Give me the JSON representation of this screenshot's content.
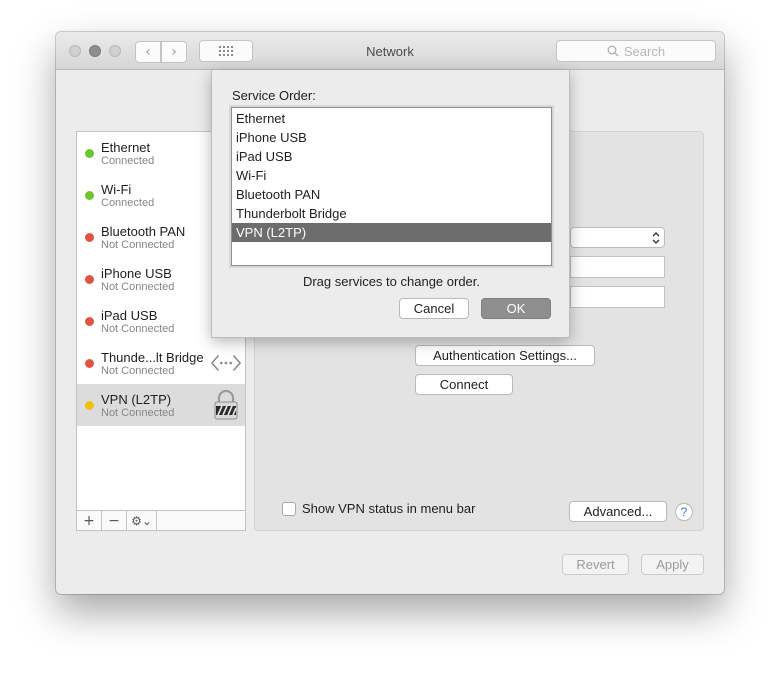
{
  "window": {
    "title": "Network",
    "search_placeholder": "Search"
  },
  "services": [
    {
      "name": "Ethernet",
      "status": "Connected",
      "color": "#6fc52e"
    },
    {
      "name": "Wi-Fi",
      "status": "Connected",
      "color": "#6fc52e"
    },
    {
      "name": "Bluetooth PAN",
      "status": "Not Connected",
      "color": "#e05540"
    },
    {
      "name": "iPhone USB",
      "status": "Not Connected",
      "color": "#e05540"
    },
    {
      "name": "iPad USB",
      "status": "Not Connected",
      "color": "#e05540"
    },
    {
      "name": "Thunde...lt Bridge",
      "status": "Not Connected",
      "color": "#e05540"
    },
    {
      "name": "VPN (L2TP)",
      "status": "Not Connected",
      "color": "#f0c010"
    }
  ],
  "sidebar_toolbar": {
    "add": "+",
    "remove": "−",
    "gear": "⚙⌄"
  },
  "detail": {
    "auth_settings_label": "Authentication Settings...",
    "connect_label": "Connect",
    "show_vpn_status_label": "Show VPN status in menu bar",
    "advanced_label": "Advanced...",
    "help_label": "?"
  },
  "footer": {
    "revert_label": "Revert",
    "apply_label": "Apply"
  },
  "sheet": {
    "label": "Service Order:",
    "order": [
      "Ethernet",
      "iPhone USB",
      "iPad USB",
      "Wi-Fi",
      "Bluetooth PAN",
      "Thunderbolt Bridge",
      "VPN (L2TP)"
    ],
    "selected": "VPN (L2TP)",
    "hint": "Drag services to change order.",
    "cancel_label": "Cancel",
    "ok_label": "OK"
  }
}
